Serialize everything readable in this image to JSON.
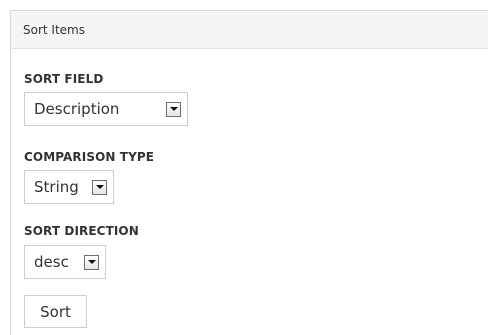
{
  "panel": {
    "title": "Sort Items"
  },
  "sort_field": {
    "label": "SORT FIELD",
    "selected": "Description"
  },
  "comparison_type": {
    "label": "COMPARISON TYPE",
    "selected": "String"
  },
  "sort_direction": {
    "label": "SORT DIRECTION",
    "selected": "desc"
  },
  "actions": {
    "sort_label": "Sort"
  },
  "icons": {
    "dropdown": "chevron-down-icon"
  },
  "colors": {
    "header_bg": "#f5f5f5",
    "border": "#cccccc",
    "text": "#333333"
  }
}
